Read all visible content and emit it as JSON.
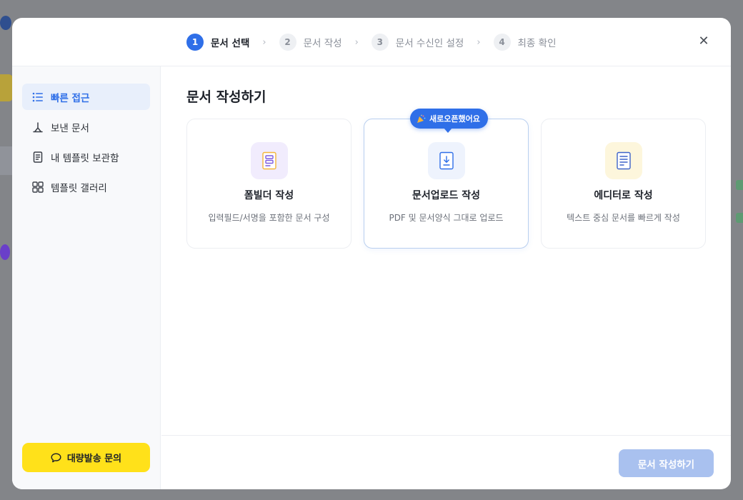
{
  "stepper": {
    "steps": [
      {
        "num": "1",
        "label": "문서 선택"
      },
      {
        "num": "2",
        "label": "문서 작성"
      },
      {
        "num": "3",
        "label": "문서 수신인 설정"
      },
      {
        "num": "4",
        "label": "최종 확인"
      }
    ],
    "separator": "›",
    "active_step": 1
  },
  "close_symbol": "✕",
  "sidebar": {
    "items": [
      {
        "label": "빠른 접근",
        "icon": "list-icon",
        "active": true
      },
      {
        "label": "보낸 문서",
        "icon": "send-icon",
        "active": false
      },
      {
        "label": "내 템플릿 보관함",
        "icon": "document-icon",
        "active": false
      },
      {
        "label": "템플릿 갤러리",
        "icon": "grid-icon",
        "active": false
      }
    ],
    "bulk_button": {
      "label": "대량발송 문의",
      "icon": "chat-bubble-icon"
    }
  },
  "main": {
    "title": "문서 작성하기",
    "cards": [
      {
        "title": "폼빌더 작성",
        "desc": "입력필드/서명을 포함한 문서 구성",
        "icon": "form-builder-icon"
      },
      {
        "title": "문서업로드 작성",
        "desc": "PDF 및 문서양식 그대로 업로드",
        "icon": "upload-document-icon",
        "badge": "새로오픈했어요"
      },
      {
        "title": "에디터로 작성",
        "desc": "텍스트 중심 문서를 빠르게 작성",
        "icon": "editor-icon"
      }
    ]
  },
  "footer": {
    "submit_label": "문서 작성하기"
  },
  "colors": {
    "accent": "#2f6fe8",
    "accent_disabled": "#a9c1ef",
    "bulk_button": "#ffe11a",
    "form_icon_bg": "#f1ecfd",
    "upload_icon_bg": "#eef3fd",
    "editor_icon_bg": "#fdf6dc"
  }
}
